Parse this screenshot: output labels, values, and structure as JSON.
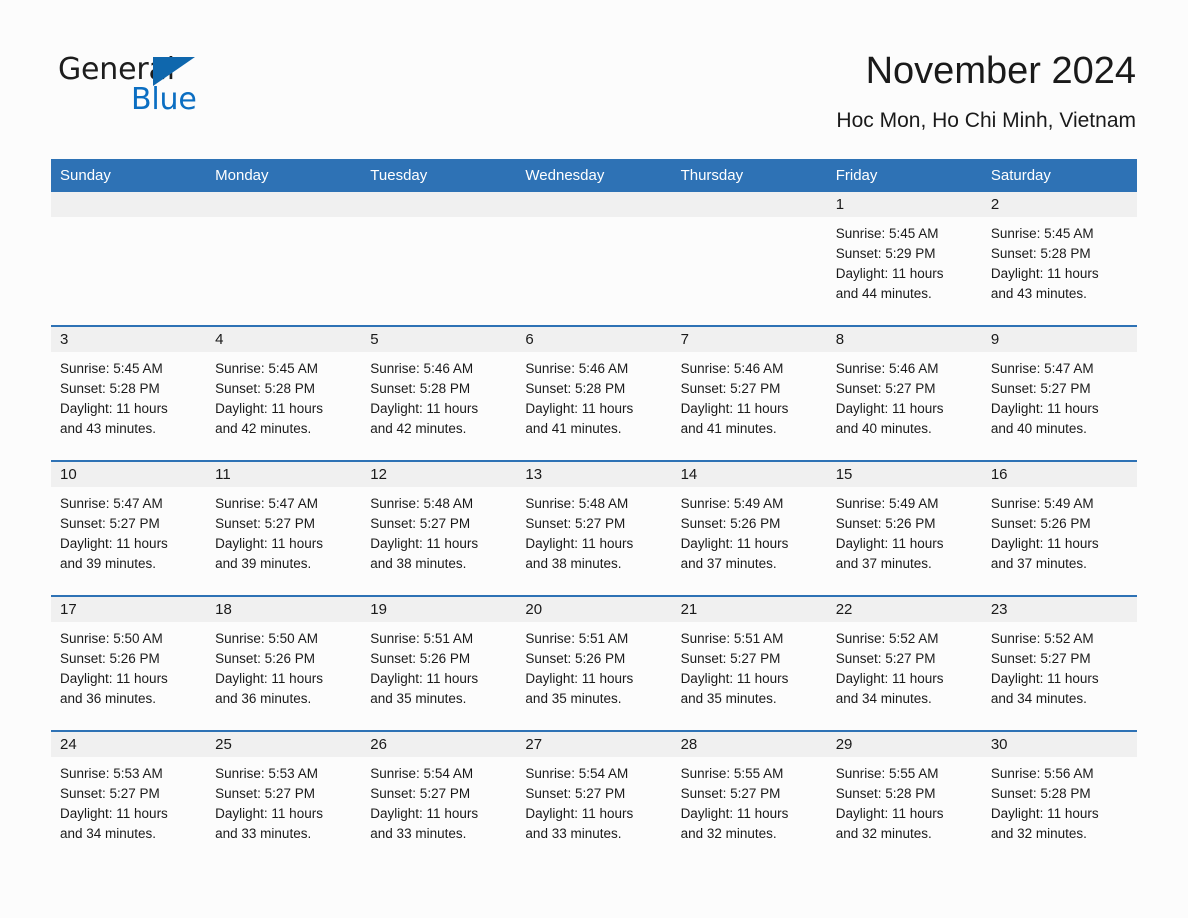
{
  "brand": {
    "name_part1": "General",
    "name_part2": "Blue",
    "accent_color": "#0f67ad"
  },
  "header": {
    "title": "November 2024",
    "location": "Hoc Mon, Ho Chi Minh, Vietnam"
  },
  "calendar": {
    "header_color": "#2e72b5",
    "weekdays": [
      "Sunday",
      "Monday",
      "Tuesday",
      "Wednesday",
      "Thursday",
      "Friday",
      "Saturday"
    ],
    "weeks": [
      [
        {
          "day": "",
          "sunrise": "",
          "sunset": "",
          "daylight1": "",
          "daylight2": ""
        },
        {
          "day": "",
          "sunrise": "",
          "sunset": "",
          "daylight1": "",
          "daylight2": ""
        },
        {
          "day": "",
          "sunrise": "",
          "sunset": "",
          "daylight1": "",
          "daylight2": ""
        },
        {
          "day": "",
          "sunrise": "",
          "sunset": "",
          "daylight1": "",
          "daylight2": ""
        },
        {
          "day": "",
          "sunrise": "",
          "sunset": "",
          "daylight1": "",
          "daylight2": ""
        },
        {
          "day": "1",
          "sunrise": "Sunrise: 5:45 AM",
          "sunset": "Sunset: 5:29 PM",
          "daylight1": "Daylight: 11 hours",
          "daylight2": "and 44 minutes."
        },
        {
          "day": "2",
          "sunrise": "Sunrise: 5:45 AM",
          "sunset": "Sunset: 5:28 PM",
          "daylight1": "Daylight: 11 hours",
          "daylight2": "and 43 minutes."
        }
      ],
      [
        {
          "day": "3",
          "sunrise": "Sunrise: 5:45 AM",
          "sunset": "Sunset: 5:28 PM",
          "daylight1": "Daylight: 11 hours",
          "daylight2": "and 43 minutes."
        },
        {
          "day": "4",
          "sunrise": "Sunrise: 5:45 AM",
          "sunset": "Sunset: 5:28 PM",
          "daylight1": "Daylight: 11 hours",
          "daylight2": "and 42 minutes."
        },
        {
          "day": "5",
          "sunrise": "Sunrise: 5:46 AM",
          "sunset": "Sunset: 5:28 PM",
          "daylight1": "Daylight: 11 hours",
          "daylight2": "and 42 minutes."
        },
        {
          "day": "6",
          "sunrise": "Sunrise: 5:46 AM",
          "sunset": "Sunset: 5:28 PM",
          "daylight1": "Daylight: 11 hours",
          "daylight2": "and 41 minutes."
        },
        {
          "day": "7",
          "sunrise": "Sunrise: 5:46 AM",
          "sunset": "Sunset: 5:27 PM",
          "daylight1": "Daylight: 11 hours",
          "daylight2": "and 41 minutes."
        },
        {
          "day": "8",
          "sunrise": "Sunrise: 5:46 AM",
          "sunset": "Sunset: 5:27 PM",
          "daylight1": "Daylight: 11 hours",
          "daylight2": "and 40 minutes."
        },
        {
          "day": "9",
          "sunrise": "Sunrise: 5:47 AM",
          "sunset": "Sunset: 5:27 PM",
          "daylight1": "Daylight: 11 hours",
          "daylight2": "and 40 minutes."
        }
      ],
      [
        {
          "day": "10",
          "sunrise": "Sunrise: 5:47 AM",
          "sunset": "Sunset: 5:27 PM",
          "daylight1": "Daylight: 11 hours",
          "daylight2": "and 39 minutes."
        },
        {
          "day": "11",
          "sunrise": "Sunrise: 5:47 AM",
          "sunset": "Sunset: 5:27 PM",
          "daylight1": "Daylight: 11 hours",
          "daylight2": "and 39 minutes."
        },
        {
          "day": "12",
          "sunrise": "Sunrise: 5:48 AM",
          "sunset": "Sunset: 5:27 PM",
          "daylight1": "Daylight: 11 hours",
          "daylight2": "and 38 minutes."
        },
        {
          "day": "13",
          "sunrise": "Sunrise: 5:48 AM",
          "sunset": "Sunset: 5:27 PM",
          "daylight1": "Daylight: 11 hours",
          "daylight2": "and 38 minutes."
        },
        {
          "day": "14",
          "sunrise": "Sunrise: 5:49 AM",
          "sunset": "Sunset: 5:26 PM",
          "daylight1": "Daylight: 11 hours",
          "daylight2": "and 37 minutes."
        },
        {
          "day": "15",
          "sunrise": "Sunrise: 5:49 AM",
          "sunset": "Sunset: 5:26 PM",
          "daylight1": "Daylight: 11 hours",
          "daylight2": "and 37 minutes."
        },
        {
          "day": "16",
          "sunrise": "Sunrise: 5:49 AM",
          "sunset": "Sunset: 5:26 PM",
          "daylight1": "Daylight: 11 hours",
          "daylight2": "and 37 minutes."
        }
      ],
      [
        {
          "day": "17",
          "sunrise": "Sunrise: 5:50 AM",
          "sunset": "Sunset: 5:26 PM",
          "daylight1": "Daylight: 11 hours",
          "daylight2": "and 36 minutes."
        },
        {
          "day": "18",
          "sunrise": "Sunrise: 5:50 AM",
          "sunset": "Sunset: 5:26 PM",
          "daylight1": "Daylight: 11 hours",
          "daylight2": "and 36 minutes."
        },
        {
          "day": "19",
          "sunrise": "Sunrise: 5:51 AM",
          "sunset": "Sunset: 5:26 PM",
          "daylight1": "Daylight: 11 hours",
          "daylight2": "and 35 minutes."
        },
        {
          "day": "20",
          "sunrise": "Sunrise: 5:51 AM",
          "sunset": "Sunset: 5:26 PM",
          "daylight1": "Daylight: 11 hours",
          "daylight2": "and 35 minutes."
        },
        {
          "day": "21",
          "sunrise": "Sunrise: 5:51 AM",
          "sunset": "Sunset: 5:27 PM",
          "daylight1": "Daylight: 11 hours",
          "daylight2": "and 35 minutes."
        },
        {
          "day": "22",
          "sunrise": "Sunrise: 5:52 AM",
          "sunset": "Sunset: 5:27 PM",
          "daylight1": "Daylight: 11 hours",
          "daylight2": "and 34 minutes."
        },
        {
          "day": "23",
          "sunrise": "Sunrise: 5:52 AM",
          "sunset": "Sunset: 5:27 PM",
          "daylight1": "Daylight: 11 hours",
          "daylight2": "and 34 minutes."
        }
      ],
      [
        {
          "day": "24",
          "sunrise": "Sunrise: 5:53 AM",
          "sunset": "Sunset: 5:27 PM",
          "daylight1": "Daylight: 11 hours",
          "daylight2": "and 34 minutes."
        },
        {
          "day": "25",
          "sunrise": "Sunrise: 5:53 AM",
          "sunset": "Sunset: 5:27 PM",
          "daylight1": "Daylight: 11 hours",
          "daylight2": "and 33 minutes."
        },
        {
          "day": "26",
          "sunrise": "Sunrise: 5:54 AM",
          "sunset": "Sunset: 5:27 PM",
          "daylight1": "Daylight: 11 hours",
          "daylight2": "and 33 minutes."
        },
        {
          "day": "27",
          "sunrise": "Sunrise: 5:54 AM",
          "sunset": "Sunset: 5:27 PM",
          "daylight1": "Daylight: 11 hours",
          "daylight2": "and 33 minutes."
        },
        {
          "day": "28",
          "sunrise": "Sunrise: 5:55 AM",
          "sunset": "Sunset: 5:27 PM",
          "daylight1": "Daylight: 11 hours",
          "daylight2": "and 32 minutes."
        },
        {
          "day": "29",
          "sunrise": "Sunrise: 5:55 AM",
          "sunset": "Sunset: 5:28 PM",
          "daylight1": "Daylight: 11 hours",
          "daylight2": "and 32 minutes."
        },
        {
          "day": "30",
          "sunrise": "Sunrise: 5:56 AM",
          "sunset": "Sunset: 5:28 PM",
          "daylight1": "Daylight: 11 hours",
          "daylight2": "and 32 minutes."
        }
      ]
    ]
  }
}
